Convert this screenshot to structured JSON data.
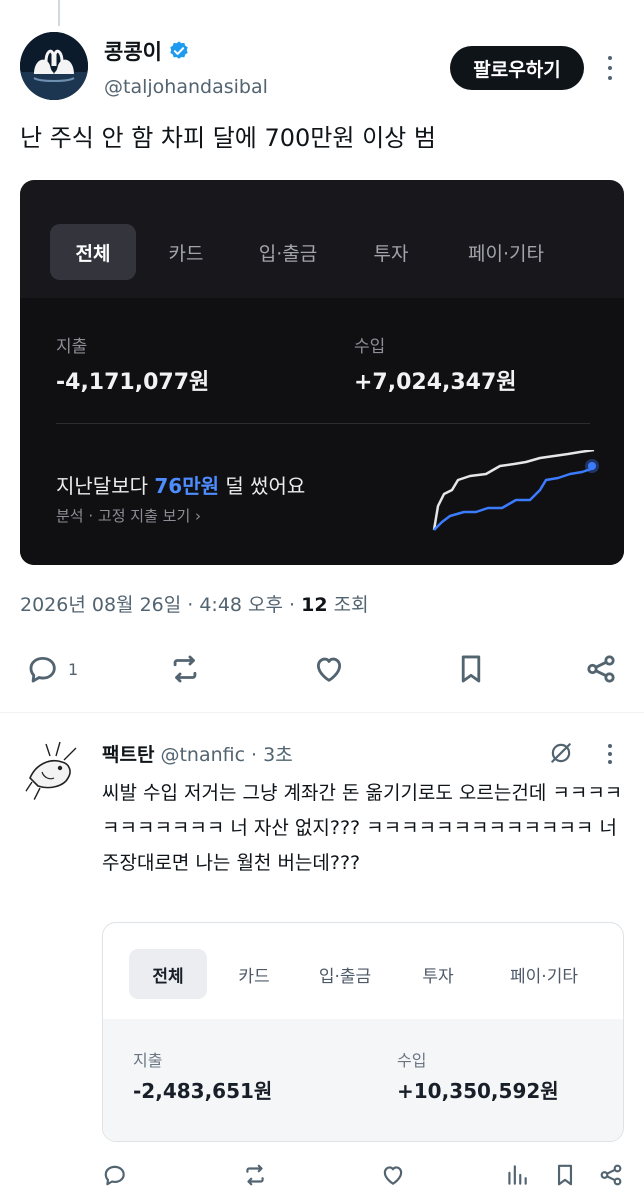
{
  "post": {
    "author_name": "콩콩이",
    "author_handle": "@taljohandasibal",
    "follow_label": "팔로우하기",
    "text": "난 주식 안 함 차피 달에 700만원 이상 범",
    "meta_date": "2026년 08월 26일 · 4:48 오후 ·",
    "views_count": "12",
    "views_label": "조회",
    "reply_count": "1",
    "card": {
      "tabs": [
        "전체",
        "카드",
        "입·출금",
        "투자",
        "페이·기타"
      ],
      "active_tab": "전체",
      "expense_label": "지출",
      "expense_value": "-4,171,077원",
      "income_label": "수입",
      "income_value": "+7,024,347원",
      "summary_prefix": "지난달보다 ",
      "summary_highlight": "76만원",
      "summary_suffix": " 덜 썼어요",
      "link_label": "분석 · 고정 지출 보기 ›"
    }
  },
  "reply": {
    "author_name": "팩트탄",
    "author_handle": "@tnanfic",
    "time": "· 3초",
    "text": "씨발 수입 저거는 그냥 계좌간 돈 옮기기로도 오르는건데 ㅋㅋㅋㅋㅋㅋㅋㅋㅋㅋㅋ 너 자산 없지??? ㅋㅋㅋㅋㅋㅋㅋㅋㅋㅋㅋㅋㅋ 너 주장대로면 나는 월천 버는데???",
    "card": {
      "tabs": [
        "전체",
        "카드",
        "입·출금",
        "투자",
        "페이·기타"
      ],
      "active_tab": "전체",
      "expense_label": "지출",
      "expense_value": "-2,483,651원",
      "income_label": "수입",
      "income_value": "+10,350,592원"
    }
  },
  "colors": {
    "accent_blue": "#1d9bf0",
    "highlight_blue": "#4d8dff",
    "text_secondary": "#536471"
  },
  "icons": [
    "verified-badge-icon",
    "more-icon",
    "reply-icon",
    "retweet-icon",
    "like-icon",
    "bookmark-icon",
    "share-icon",
    "grok-icon",
    "views-icon"
  ]
}
